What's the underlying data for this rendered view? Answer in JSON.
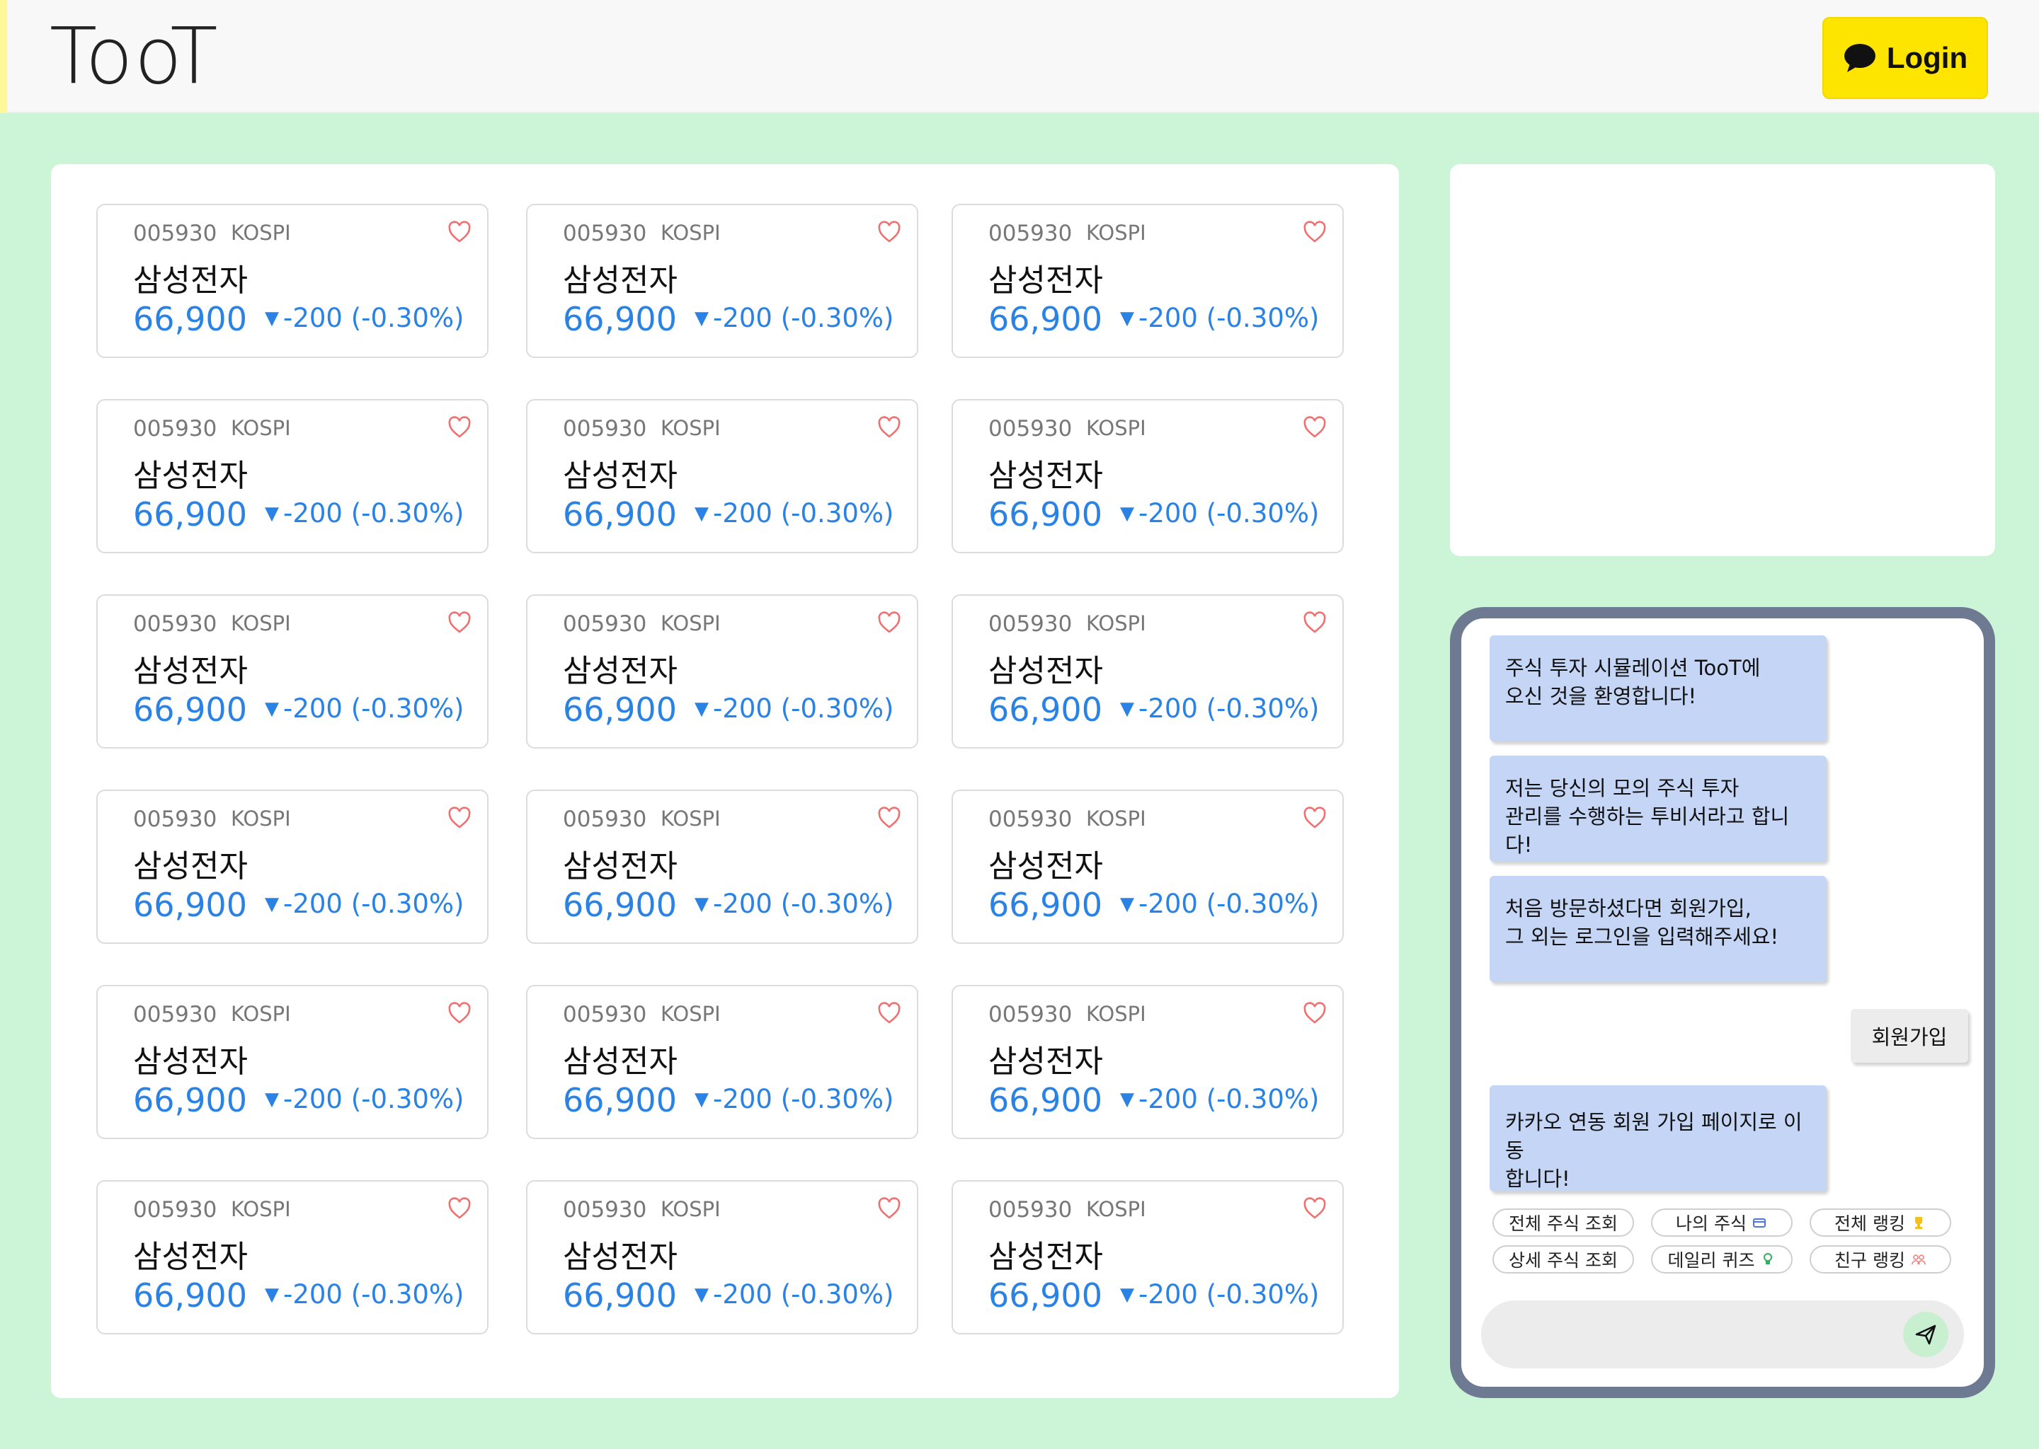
{
  "header": {
    "logo": "TooT",
    "login_label": "Login"
  },
  "stocks": [
    {
      "code": "005930",
      "market": "KOSPI",
      "name": "삼성전자",
      "price": "66,900",
      "change": "-200 (-0.30%)"
    },
    {
      "code": "005930",
      "market": "KOSPI",
      "name": "삼성전자",
      "price": "66,900",
      "change": "-200 (-0.30%)"
    },
    {
      "code": "005930",
      "market": "KOSPI",
      "name": "삼성전자",
      "price": "66,900",
      "change": "-200 (-0.30%)"
    },
    {
      "code": "005930",
      "market": "KOSPI",
      "name": "삼성전자",
      "price": "66,900",
      "change": "-200 (-0.30%)"
    },
    {
      "code": "005930",
      "market": "KOSPI",
      "name": "삼성전자",
      "price": "66,900",
      "change": "-200 (-0.30%)"
    },
    {
      "code": "005930",
      "market": "KOSPI",
      "name": "삼성전자",
      "price": "66,900",
      "change": "-200 (-0.30%)"
    },
    {
      "code": "005930",
      "market": "KOSPI",
      "name": "삼성전자",
      "price": "66,900",
      "change": "-200 (-0.30%)"
    },
    {
      "code": "005930",
      "market": "KOSPI",
      "name": "삼성전자",
      "price": "66,900",
      "change": "-200 (-0.30%)"
    },
    {
      "code": "005930",
      "market": "KOSPI",
      "name": "삼성전자",
      "price": "66,900",
      "change": "-200 (-0.30%)"
    },
    {
      "code": "005930",
      "market": "KOSPI",
      "name": "삼성전자",
      "price": "66,900",
      "change": "-200 (-0.30%)"
    },
    {
      "code": "005930",
      "market": "KOSPI",
      "name": "삼성전자",
      "price": "66,900",
      "change": "-200 (-0.30%)"
    },
    {
      "code": "005930",
      "market": "KOSPI",
      "name": "삼성전자",
      "price": "66,900",
      "change": "-200 (-0.30%)"
    },
    {
      "code": "005930",
      "market": "KOSPI",
      "name": "삼성전자",
      "price": "66,900",
      "change": "-200 (-0.30%)"
    },
    {
      "code": "005930",
      "market": "KOSPI",
      "name": "삼성전자",
      "price": "66,900",
      "change": "-200 (-0.30%)"
    },
    {
      "code": "005930",
      "market": "KOSPI",
      "name": "삼성전자",
      "price": "66,900",
      "change": "-200 (-0.30%)"
    },
    {
      "code": "005930",
      "market": "KOSPI",
      "name": "삼성전자",
      "price": "66,900",
      "change": "-200 (-0.30%)"
    },
    {
      "code": "005930",
      "market": "KOSPI",
      "name": "삼성전자",
      "price": "66,900",
      "change": "-200 (-0.30%)"
    },
    {
      "code": "005930",
      "market": "KOSPI",
      "name": "삼성전자",
      "price": "66,900",
      "change": "-200 (-0.30%)"
    }
  ],
  "chat": {
    "bot_messages": [
      [
        "주식 투자 시뮬레이션 TooT에",
        "오신 것을 환영합니다!"
      ],
      [
        "저는 당신의 모의 주식 투자",
        "관리를 수행하는 투비서라고 합니다!"
      ],
      [
        "처음 방문하셨다면 회원가입,",
        "그 외는 로그인을 입력해주세요!"
      ],
      [
        "카카오 연동 회원 가입 페이지로 이동",
        "합니다!"
      ]
    ],
    "user_message": "회원가입",
    "chips": [
      {
        "label": "전체 주식 조회",
        "icon": ""
      },
      {
        "label": "나의 주식",
        "icon": "card-icon"
      },
      {
        "label": "전체 랭킹",
        "icon": "trophy-icon"
      },
      {
        "label": "상세 주식 조회",
        "icon": ""
      },
      {
        "label": "데일리 퀴즈",
        "icon": "bulb-icon"
      },
      {
        "label": "친구 랭킹",
        "icon": "friends-icon"
      }
    ],
    "input_value": ""
  },
  "colors": {
    "background": "#ccf5d8",
    "login_yellow": "#fee500",
    "price_blue": "#2a82e4",
    "heart_red": "#f07070",
    "bot_bubble": "#c5d5f5",
    "chat_border": "#6e7a91"
  }
}
